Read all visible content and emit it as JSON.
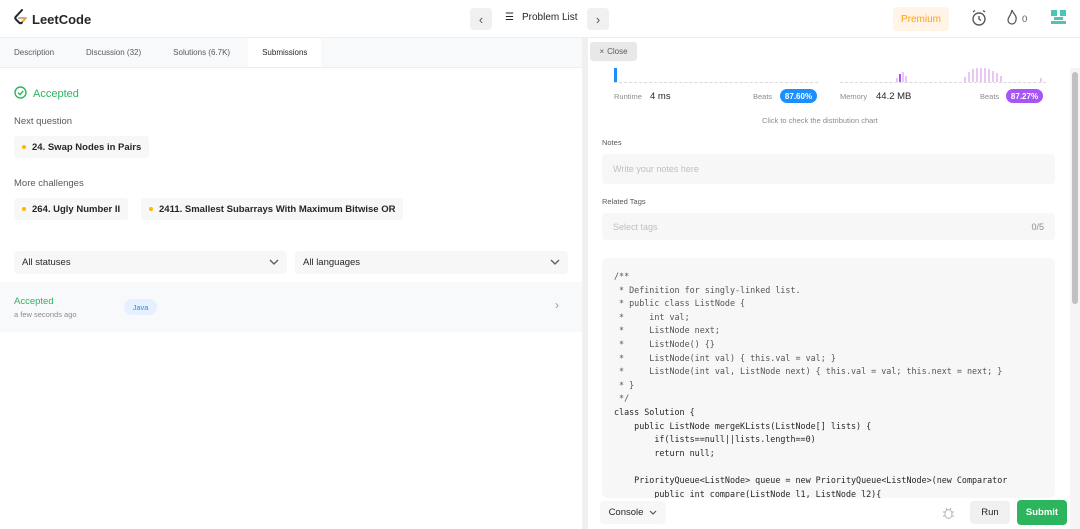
{
  "header": {
    "logo_text": "LeetCode",
    "problem_list_label": "Problem List",
    "premium_label": "Premium",
    "streak_count": "0"
  },
  "left_tabs": [
    {
      "label": "Description"
    },
    {
      "label": "Discussion (32)"
    },
    {
      "label": "Solutions (6.7K)"
    },
    {
      "label": "Submissions"
    }
  ],
  "result": {
    "status": "Accepted",
    "next_question_label": "Next question",
    "next_question": "24. Swap Nodes in Pairs",
    "more_challenges_label": "More challenges",
    "challenges": [
      "264. Ugly Number II",
      "2411. Smallest Subarrays With Maximum Bitwise OR"
    ]
  },
  "filters": {
    "status_select": "All statuses",
    "language_select": "All languages"
  },
  "submission_row": {
    "status": "Accepted",
    "time": "a few seconds ago",
    "language": "Java"
  },
  "right": {
    "close_label": "Close",
    "runtime_label": "Runtime",
    "runtime_value": "4 ms",
    "runtime_beats_label": "Beats",
    "runtime_beats": "87.60%",
    "memory_label": "Memory",
    "memory_value": "44.2 MB",
    "memory_beats_label": "Beats",
    "memory_beats": "87.27%",
    "distribution_hint": "Click to check the distribution chart",
    "notes_label": "Notes",
    "notes_placeholder": "Write your notes here",
    "tags_label": "Related Tags",
    "tags_placeholder": "Select tags",
    "tags_count": "0/5"
  },
  "code_lines": [
    "/**",
    " * Definition for singly-linked list.",
    " * public class ListNode {",
    " *     int val;",
    " *     ListNode next;",
    " *     ListNode() {}",
    " *     ListNode(int val) { this.val = val; }",
    " *     ListNode(int val, ListNode next) { this.val = val; this.next = next; }",
    " * }",
    " */",
    "class Solution {",
    "    public ListNode mergeKLists(ListNode[] lists) {",
    "        if(lists==null||lists.length==0)",
    "        return null;",
    "",
    "    PriorityQueue<ListNode> queue = new PriorityQueue<ListNode>(new Comparator",
    "        public int compare(ListNode l1, ListNode l2){"
  ],
  "bottom": {
    "console_label": "Console",
    "run_label": "Run",
    "submit_label": "Submit"
  },
  "colors": {
    "accent_green": "#2db55d",
    "brand_orange": "#ffa116",
    "runtime_badge": "#1a90ff",
    "memory_badge": "#a855f7"
  }
}
